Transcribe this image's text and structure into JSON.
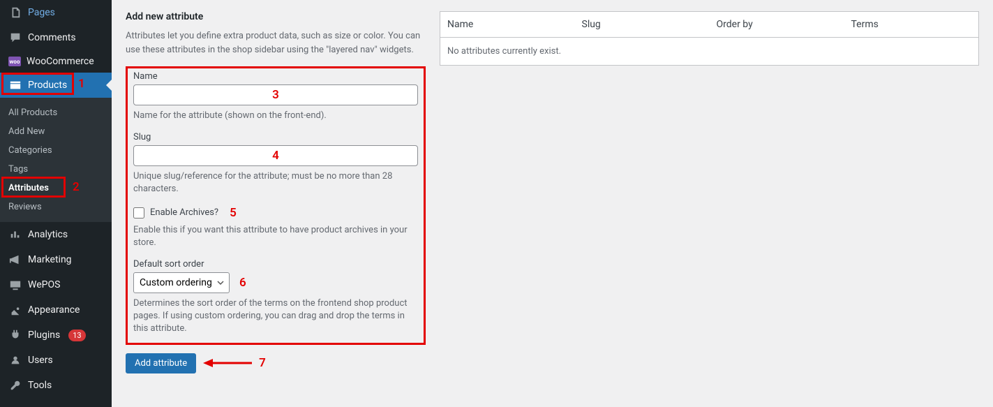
{
  "sidebar": {
    "pages": "Pages",
    "comments": "Comments",
    "woocommerce": "WooCommerce",
    "products": "Products",
    "submenu": {
      "all_products": "All Products",
      "add_new": "Add New",
      "categories": "Categories",
      "tags": "Tags",
      "attributes": "Attributes",
      "reviews": "Reviews"
    },
    "analytics": "Analytics",
    "marketing": "Marketing",
    "wepos": "WePOS",
    "appearance": "Appearance",
    "plugins": "Plugins",
    "plugins_count": "13",
    "users": "Users",
    "tools": "Tools"
  },
  "annotations": {
    "n1": "1",
    "n2": "2",
    "n3": "3",
    "n4": "4",
    "n5": "5",
    "n6": "6",
    "n7": "7"
  },
  "form": {
    "title": "Add new attribute",
    "intro": "Attributes let you define extra product data, such as size or color. You can use these attributes in the shop sidebar using the \"layered nav\" widgets.",
    "name_label": "Name",
    "name_help": "Name for the attribute (shown on the front-end).",
    "slug_label": "Slug",
    "slug_help": "Unique slug/reference for the attribute; must be no more than 28 characters.",
    "archives_label": "Enable Archives?",
    "archives_help": "Enable this if you want this attribute to have product archives in your store.",
    "sort_label": "Default sort order",
    "sort_value": "Custom ordering",
    "sort_help": "Determines the sort order of the terms on the frontend shop product pages. If using custom ordering, you can drag and drop the terms in this attribute.",
    "submit": "Add attribute"
  },
  "table": {
    "col_name": "Name",
    "col_slug": "Slug",
    "col_order": "Order by",
    "col_terms": "Terms",
    "empty": "No attributes currently exist."
  }
}
